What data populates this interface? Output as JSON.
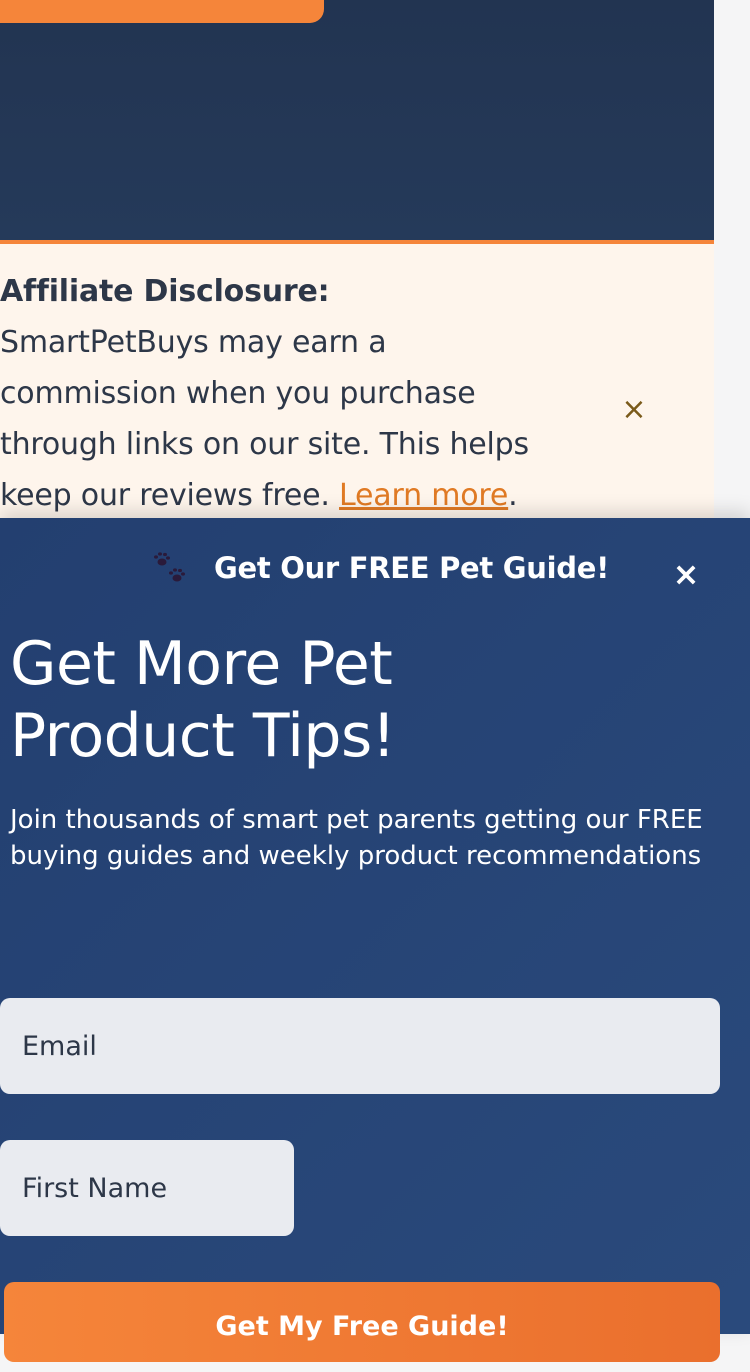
{
  "disclosure": {
    "bold": "Affiliate Disclosure:",
    "text": " SmartPetBuys may earn a commission when you purchase through links on our site. This helps keep our reviews free. ",
    "link": "Learn more",
    "period": ".",
    "close": "×"
  },
  "modal": {
    "header_title": "Get Our FREE Pet Guide!",
    "close": "×",
    "title": "Get More Pet Product Tips!",
    "subtitle": "Join thousands of smart pet parents getting our FREE buying guides and weekly product recommendations",
    "email_placeholder": "Email",
    "first_name_placeholder": "First Name",
    "submit_label": "Get My Free Guide!"
  },
  "colors": {
    "accent": "#f5853a",
    "hero_bg": "#223451",
    "modal_bg": "#233f70",
    "disclosure_bg": "#fef5ec"
  }
}
